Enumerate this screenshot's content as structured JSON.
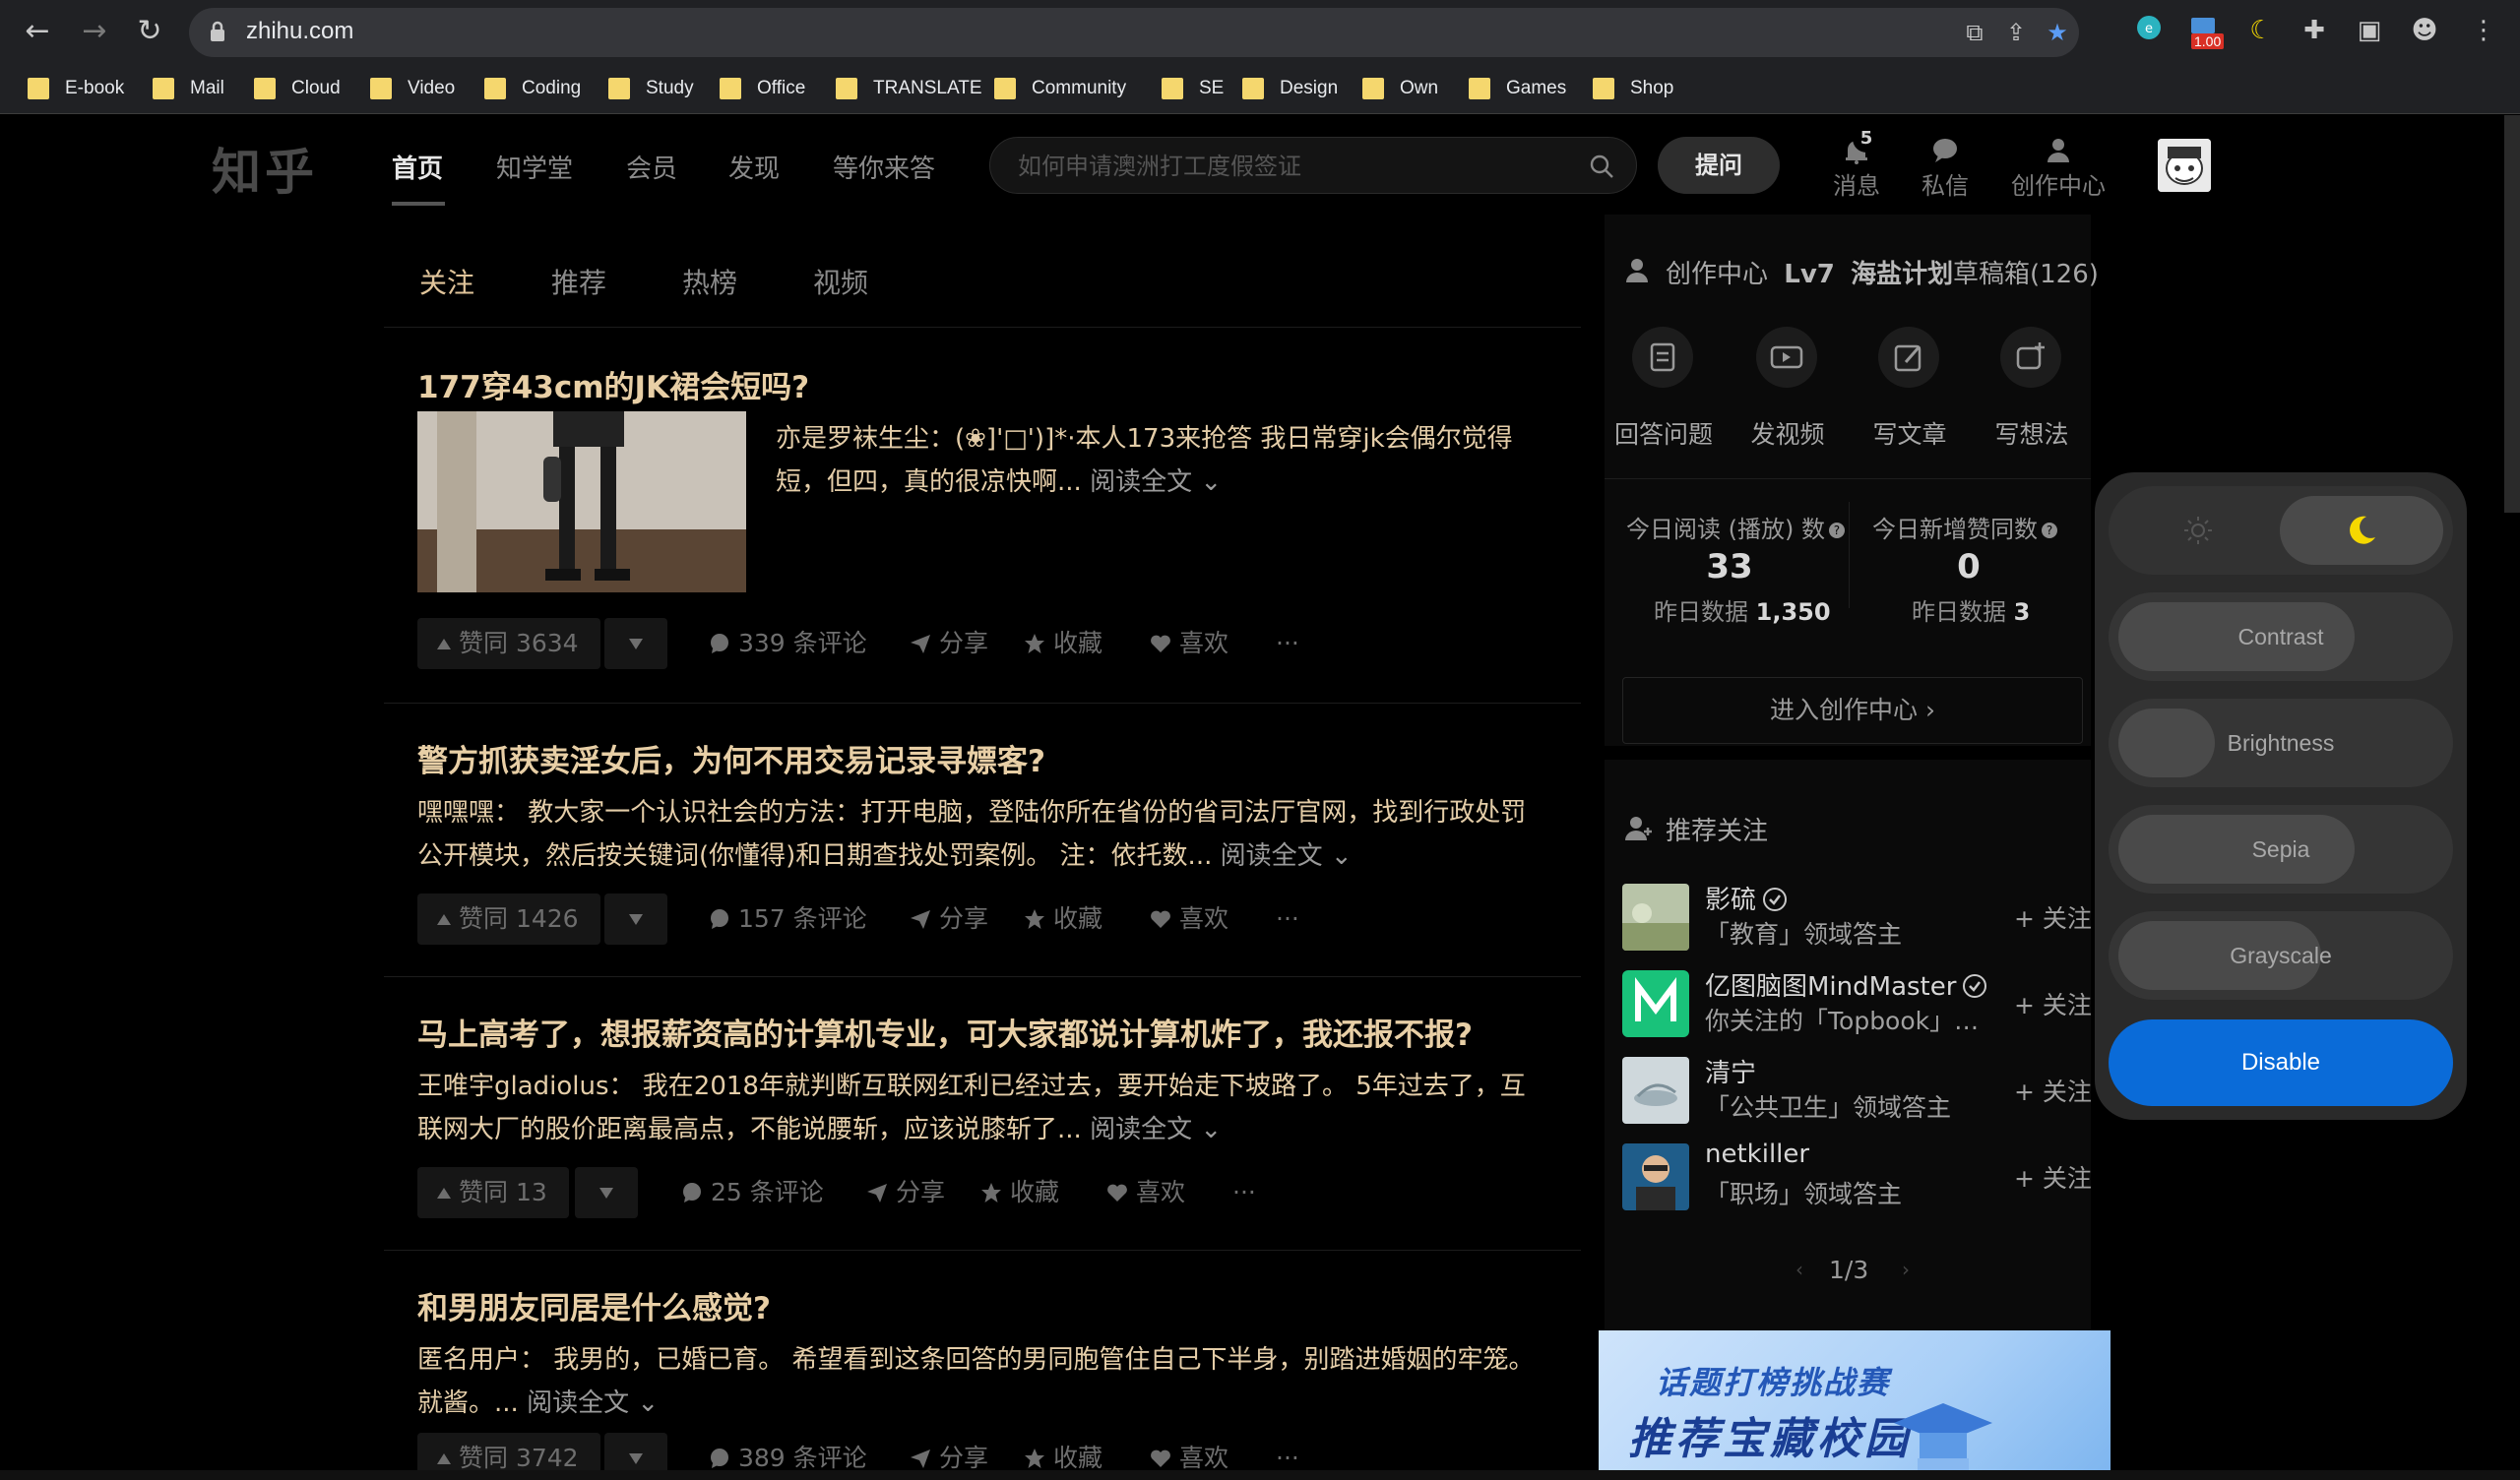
{
  "browser": {
    "url": "zhihu.com",
    "bookmarks": [
      "E-book",
      "Mail",
      "Cloud",
      "Video",
      "Coding",
      "Study",
      "Office",
      "TRANSLATE",
      "Community",
      "SE",
      "Design",
      "Own",
      "Games",
      "Shop"
    ],
    "ext_badge": "1.00"
  },
  "header": {
    "logo": "知乎",
    "nav": [
      "首页",
      "知学堂",
      "会员",
      "发现",
      "等你来答"
    ],
    "search_placeholder": "如何申请澳洲打工度假签证",
    "ask_label": "提问",
    "messages_label": "消息",
    "messages_count": "5",
    "dm_label": "私信",
    "creator_label": "创作中心"
  },
  "feed": {
    "tabs": [
      "关注",
      "推荐",
      "热榜",
      "视频"
    ],
    "items": [
      {
        "title": "177穿43cm的JK裙会短吗?",
        "excerpt": "亦是罗袜生尘：(❀]'□')]*·本人173来抢答 我日常穿jk会偶尔觉得短，但四，真的很凉快啊...",
        "read_all": "阅读全文",
        "votes": "赞同 3634",
        "comments": "339 条评论",
        "share": "分享",
        "collect": "收藏",
        "like": "喜欢",
        "more": "···"
      },
      {
        "title": "警方抓获卖淫女后，为何不用交易记录寻嫖客?",
        "excerpt": "嘿嘿嘿： 教大家一个认识社会的方法：打开电脑，登陆你所在省份的省司法厅官网，找到行政处罚公开模块，然后按关键词(你懂得)和日期查找处罚案例。 注：依托数...",
        "read_all": "阅读全文",
        "votes": "赞同 1426",
        "comments": "157 条评论",
        "share": "分享",
        "collect": "收藏",
        "like": "喜欢",
        "more": "···"
      },
      {
        "title": "马上高考了，想报薪资高的计算机专业，可大家都说计算机炸了，我还报不报?",
        "excerpt": "王唯宇gladiolus： 我在2018年就判断互联网红利已经过去，要开始走下坡路了。 5年过去了，互联网大厂的股价距离最高点，不能说腰斩，应该说膝斩了...",
        "read_all": "阅读全文",
        "votes": "赞同 13",
        "comments": "25 条评论",
        "share": "分享",
        "collect": "收藏",
        "like": "喜欢",
        "more": "···"
      },
      {
        "title": "和男朋友同居是什么感觉?",
        "excerpt": "匿名用户： 我男的，已婚已育。 希望看到这条回答的男同胞管住自己下半身，别踏进婚姻的牢笼。就酱。...",
        "read_all": "阅读全文",
        "votes": "赞同 3742",
        "comments": "389 条评论",
        "share": "分享",
        "collect": "收藏",
        "like": "喜欢",
        "more": "···"
      }
    ]
  },
  "sidebar": {
    "creator_title": "创作中心",
    "level": "Lv7",
    "plan": "海盐计划",
    "drafts": "草稿箱(126)",
    "tools": [
      "回答问题",
      "发视频",
      "写文章",
      "写想法"
    ],
    "stats": {
      "read_label": "今日阅读 (播放) 数",
      "read_value": "33",
      "read_yesterday_label": "昨日数据",
      "read_yesterday": "1,350",
      "likes_label": "今日新增赞同数",
      "likes_value": "0",
      "likes_yesterday_label": "昨日数据",
      "likes_yesterday": "3"
    },
    "enter_creator": "进入创作中心 ›",
    "rec_title": "推荐关注",
    "recommendations": [
      {
        "name": "影硫",
        "desc": "「教育」领域答主",
        "follow": "+ 关注",
        "verified": true
      },
      {
        "name": "亿图脑图MindMaster",
        "desc": "你关注的「Topbook」…",
        "follow": "+ 关注",
        "verified": true
      },
      {
        "name": "清宁",
        "desc": "「公共卫生」领域答主",
        "follow": "+ 关注",
        "verified": false
      },
      {
        "name": "netkiller",
        "desc": "「职场」领域答主",
        "follow": "+ 关注",
        "verified": false
      }
    ],
    "pager": "1/3",
    "banner_line1": "话题打榜挑战赛",
    "banner_line2": "推荐宝藏校园"
  },
  "dark_reader": {
    "contrast": "Contrast",
    "brightness": "Brightness",
    "sepia": "Sepia",
    "grayscale": "Grayscale",
    "disable": "Disable"
  }
}
